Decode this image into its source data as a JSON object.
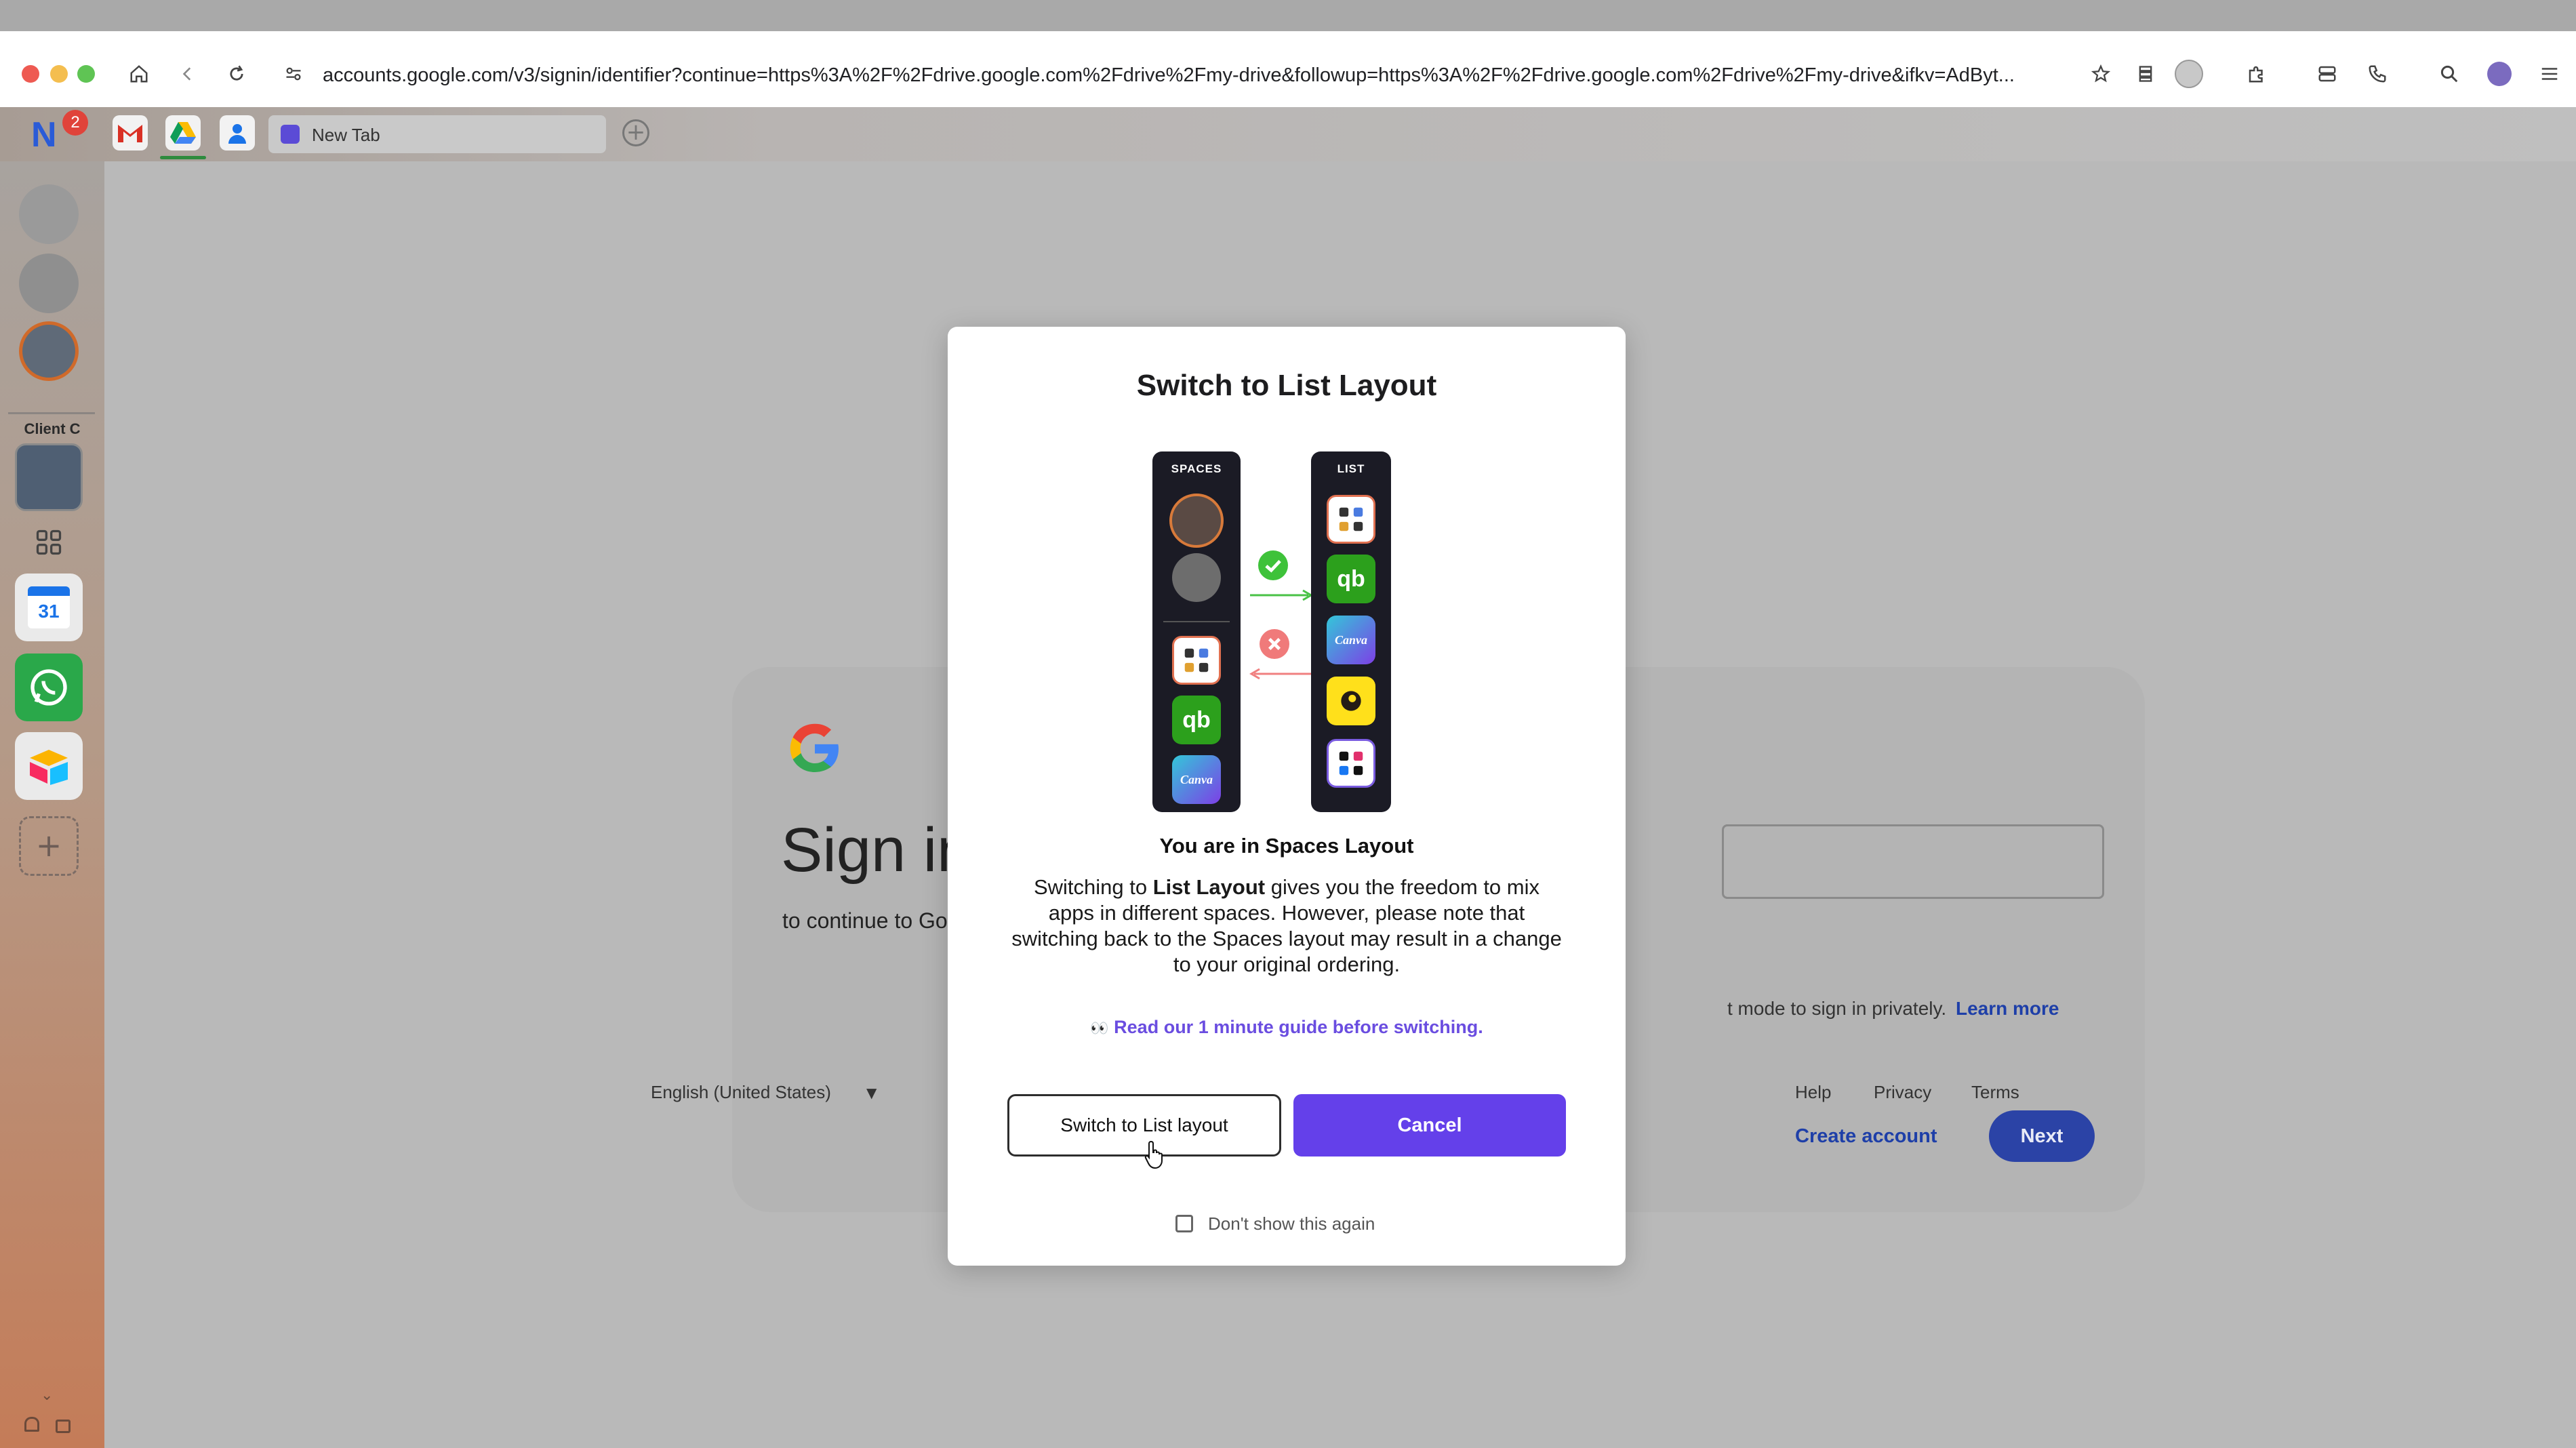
{
  "browser": {
    "url": "accounts.google.com/v3/signin/identifier?continue=https%3A%2F%2Fdrive.google.com%2Fdrive%2Fmy-drive&followup=https%3A%2F%2Fdrive.google.com%2Fdrive%2Fmy-drive&ifkv=AdByt...",
    "tab_label": "New Tab",
    "notification_count": "2",
    "colors": {
      "close": "#ee5a52",
      "minimize": "#f4be4f",
      "maximize": "#5fc454"
    }
  },
  "sidebar": {
    "client_label": "Client C",
    "calendar_day": "31"
  },
  "background_page": {
    "title": "Sign in",
    "subtitle": "to continue to Google Drive",
    "guest_text": "t mode to sign in privately.",
    "learn_more": "Learn more",
    "create_account": "Create account",
    "next": "Next",
    "language": "English (United States)",
    "footer_links": [
      "Help",
      "Privacy",
      "Terms"
    ]
  },
  "modal": {
    "title": "Switch to List Layout",
    "illustration": {
      "spaces_label": "SPACES",
      "list_label": "LIST",
      "canva": "Canva"
    },
    "subheading": "You are in Spaces Layout",
    "description_prefix": "Switching to ",
    "description_bold": "List Layout",
    "description_suffix": " gives you the freedom to mix apps in different spaces. However, please note that switching back to the Spaces layout may result in a change to your original ordering.",
    "guide_emoji": "👀",
    "guide_link": "Read our 1 minute guide before switching.",
    "switch_button": "Switch to List layout",
    "cancel_button": "Cancel",
    "dont_show_label": "Don't show this again",
    "accent_color": "#6440ea"
  }
}
